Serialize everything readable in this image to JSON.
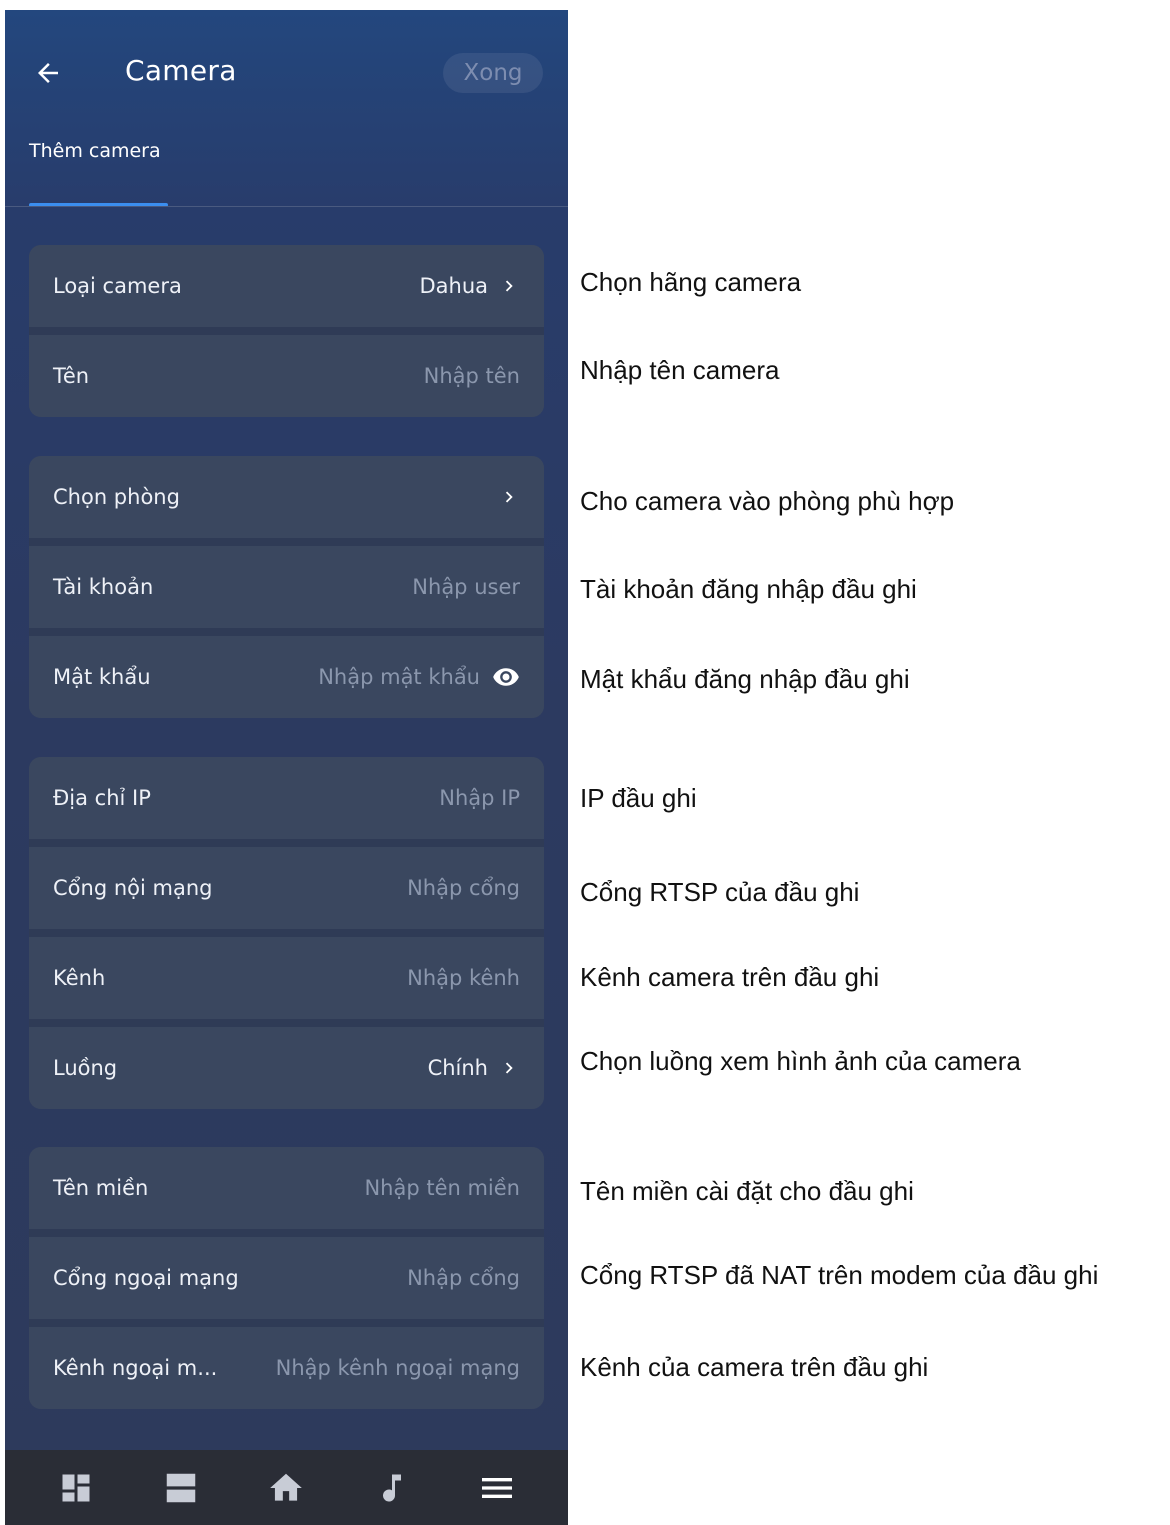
{
  "header": {
    "title": "Camera",
    "done_label": "Xong",
    "tab": "Thêm camera"
  },
  "groups": [
    [
      {
        "label": "Loại camera",
        "value": "Dahua",
        "chevron": true,
        "filled": true
      },
      {
        "label": "Tên",
        "value": "Nhập tên"
      }
    ],
    [
      {
        "label": "Chọn phòng",
        "value": "",
        "chevron": true
      },
      {
        "label": "Tài khoản",
        "value": "Nhập user"
      },
      {
        "label": "Mật khẩu",
        "value": "Nhập mật khẩu",
        "eye": true
      }
    ],
    [
      {
        "label": "Địa chỉ IP",
        "value": "Nhập IP"
      },
      {
        "label": "Cổng nội mạng",
        "value": "Nhập cổng"
      },
      {
        "label": "Kênh",
        "value": "Nhập kênh"
      },
      {
        "label": "Luồng",
        "value": "Chính",
        "chevron": true,
        "filled": true
      }
    ],
    [
      {
        "label": "Tên miền",
        "value": "Nhập tên miền"
      },
      {
        "label": "Cổng ngoại mạng",
        "value": "Nhập cổng"
      },
      {
        "label": "Kênh ngoại m...",
        "value": "Nhập kênh ngoại mạng"
      }
    ]
  ],
  "annotations": [
    "Chọn hãng camera",
    "Nhập tên camera",
    "Cho camera vào phòng phù hợp",
    "Tài khoản đăng nhập đầu ghi",
    "Mật khẩu đăng nhập đầu ghi",
    "IP đầu ghi",
    "Cổng RTSP của đầu ghi",
    "Kênh camera trên đầu ghi",
    "Chọn luồng xem hình ảnh của camera",
    "Tên miền cài đặt cho đầu ghi",
    "Cổng RTSP đã NAT trên modem của đầu ghi",
    "Kênh của camera trên đầu ghi"
  ],
  "bottom_nav": [
    {
      "icon": "dashboard-icon"
    },
    {
      "icon": "view-agenda-icon"
    },
    {
      "icon": "home-icon"
    },
    {
      "icon": "music-note-icon"
    },
    {
      "icon": "menu-icon"
    }
  ],
  "colors": {
    "card": "#3a475f",
    "accent": "#3b8ef0",
    "placeholder": "#8b97ad"
  }
}
